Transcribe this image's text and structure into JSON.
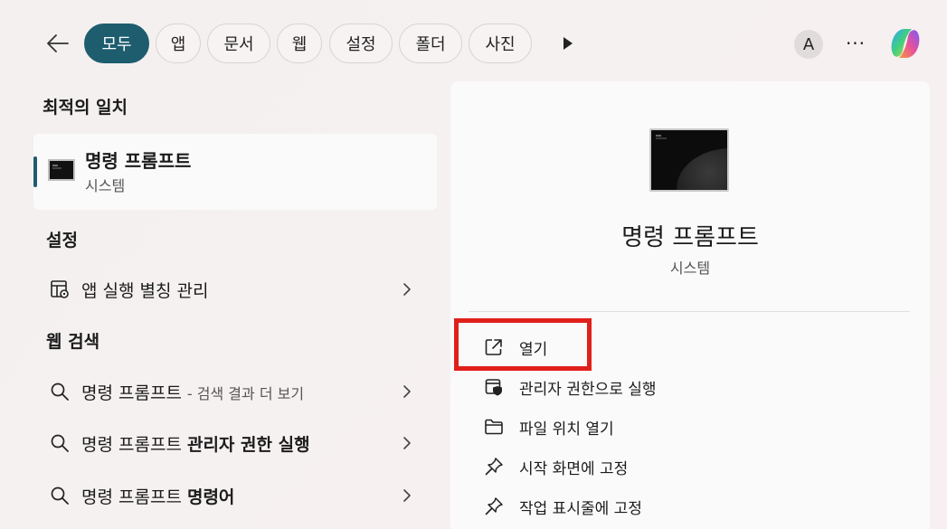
{
  "topbar": {
    "tabs": [
      "모두",
      "앱",
      "문서",
      "웹",
      "설정",
      "폴더",
      "사진"
    ],
    "active_tab": 0,
    "avatar_letter": "A",
    "more_label": "···"
  },
  "best_match": {
    "section_title": "최적의 일치",
    "title": "명령 프롬프트",
    "subtitle": "시스템"
  },
  "settings": {
    "section_title": "설정",
    "items": [
      {
        "label": "앱 실행 별칭 관리",
        "icon": "app-alias-icon"
      }
    ]
  },
  "web_search": {
    "section_title": "웹 검색",
    "items": [
      {
        "prefix": "명령 프롬프트",
        "bold": "",
        "hint": "- 검색 결과 더 보기"
      },
      {
        "prefix": "명령 프롬프트 ",
        "bold": "관리자 권한 실행",
        "hint": ""
      },
      {
        "prefix": "명령 프롬프트 ",
        "bold": "명령어",
        "hint": ""
      }
    ]
  },
  "detail": {
    "title": "명령 프롬프트",
    "subtitle": "시스템",
    "actions": [
      {
        "label": "열기",
        "icon": "open-external-icon"
      },
      {
        "label": "관리자 권한으로 실행",
        "icon": "admin-shield-icon"
      },
      {
        "label": "파일 위치 열기",
        "icon": "folder-icon"
      },
      {
        "label": "시작 화면에 고정",
        "icon": "pin-icon"
      },
      {
        "label": "작업 표시줄에 고정",
        "icon": "pin-icon"
      }
    ]
  },
  "colors": {
    "accent": "#1d5d6e",
    "highlight": "#e0201b"
  }
}
